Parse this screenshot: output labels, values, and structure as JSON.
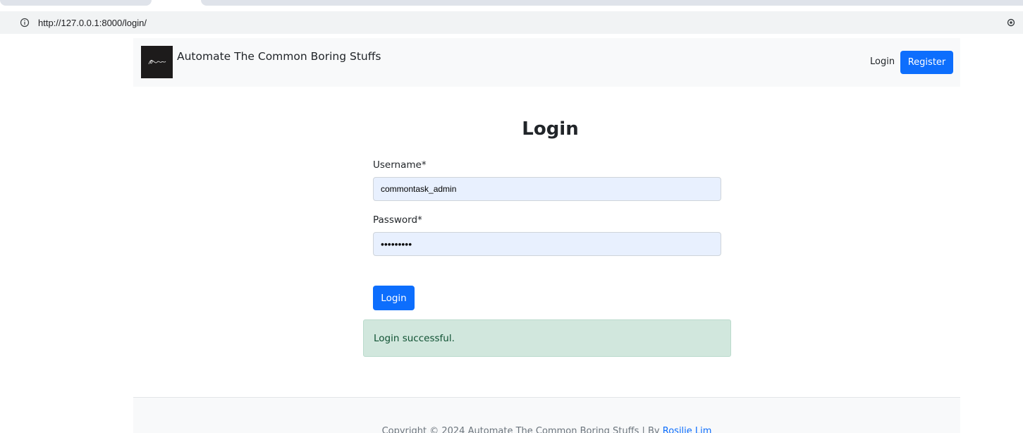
{
  "browser": {
    "url": "http://127.0.0.1:8000/login/"
  },
  "navbar": {
    "brand": "Automate The Common Boring Stuffs",
    "login_link": "Login",
    "register_button": "Register"
  },
  "form": {
    "title": "Login",
    "username_label": "Username*",
    "username_value": "commontask_admin",
    "password_label": "Password*",
    "password_value": "•••••••••",
    "submit_label": "Login"
  },
  "alert": {
    "message": "Login successful.",
    "color": "#d1e7dd"
  },
  "footer": {
    "copyright": "Copyright © 2024 Automate The Common Boring Stuffs | By ",
    "author": "Rosilie Lim"
  },
  "colors": {
    "primary": "#0d6efd",
    "navbar_bg": "#f8f9fa"
  }
}
